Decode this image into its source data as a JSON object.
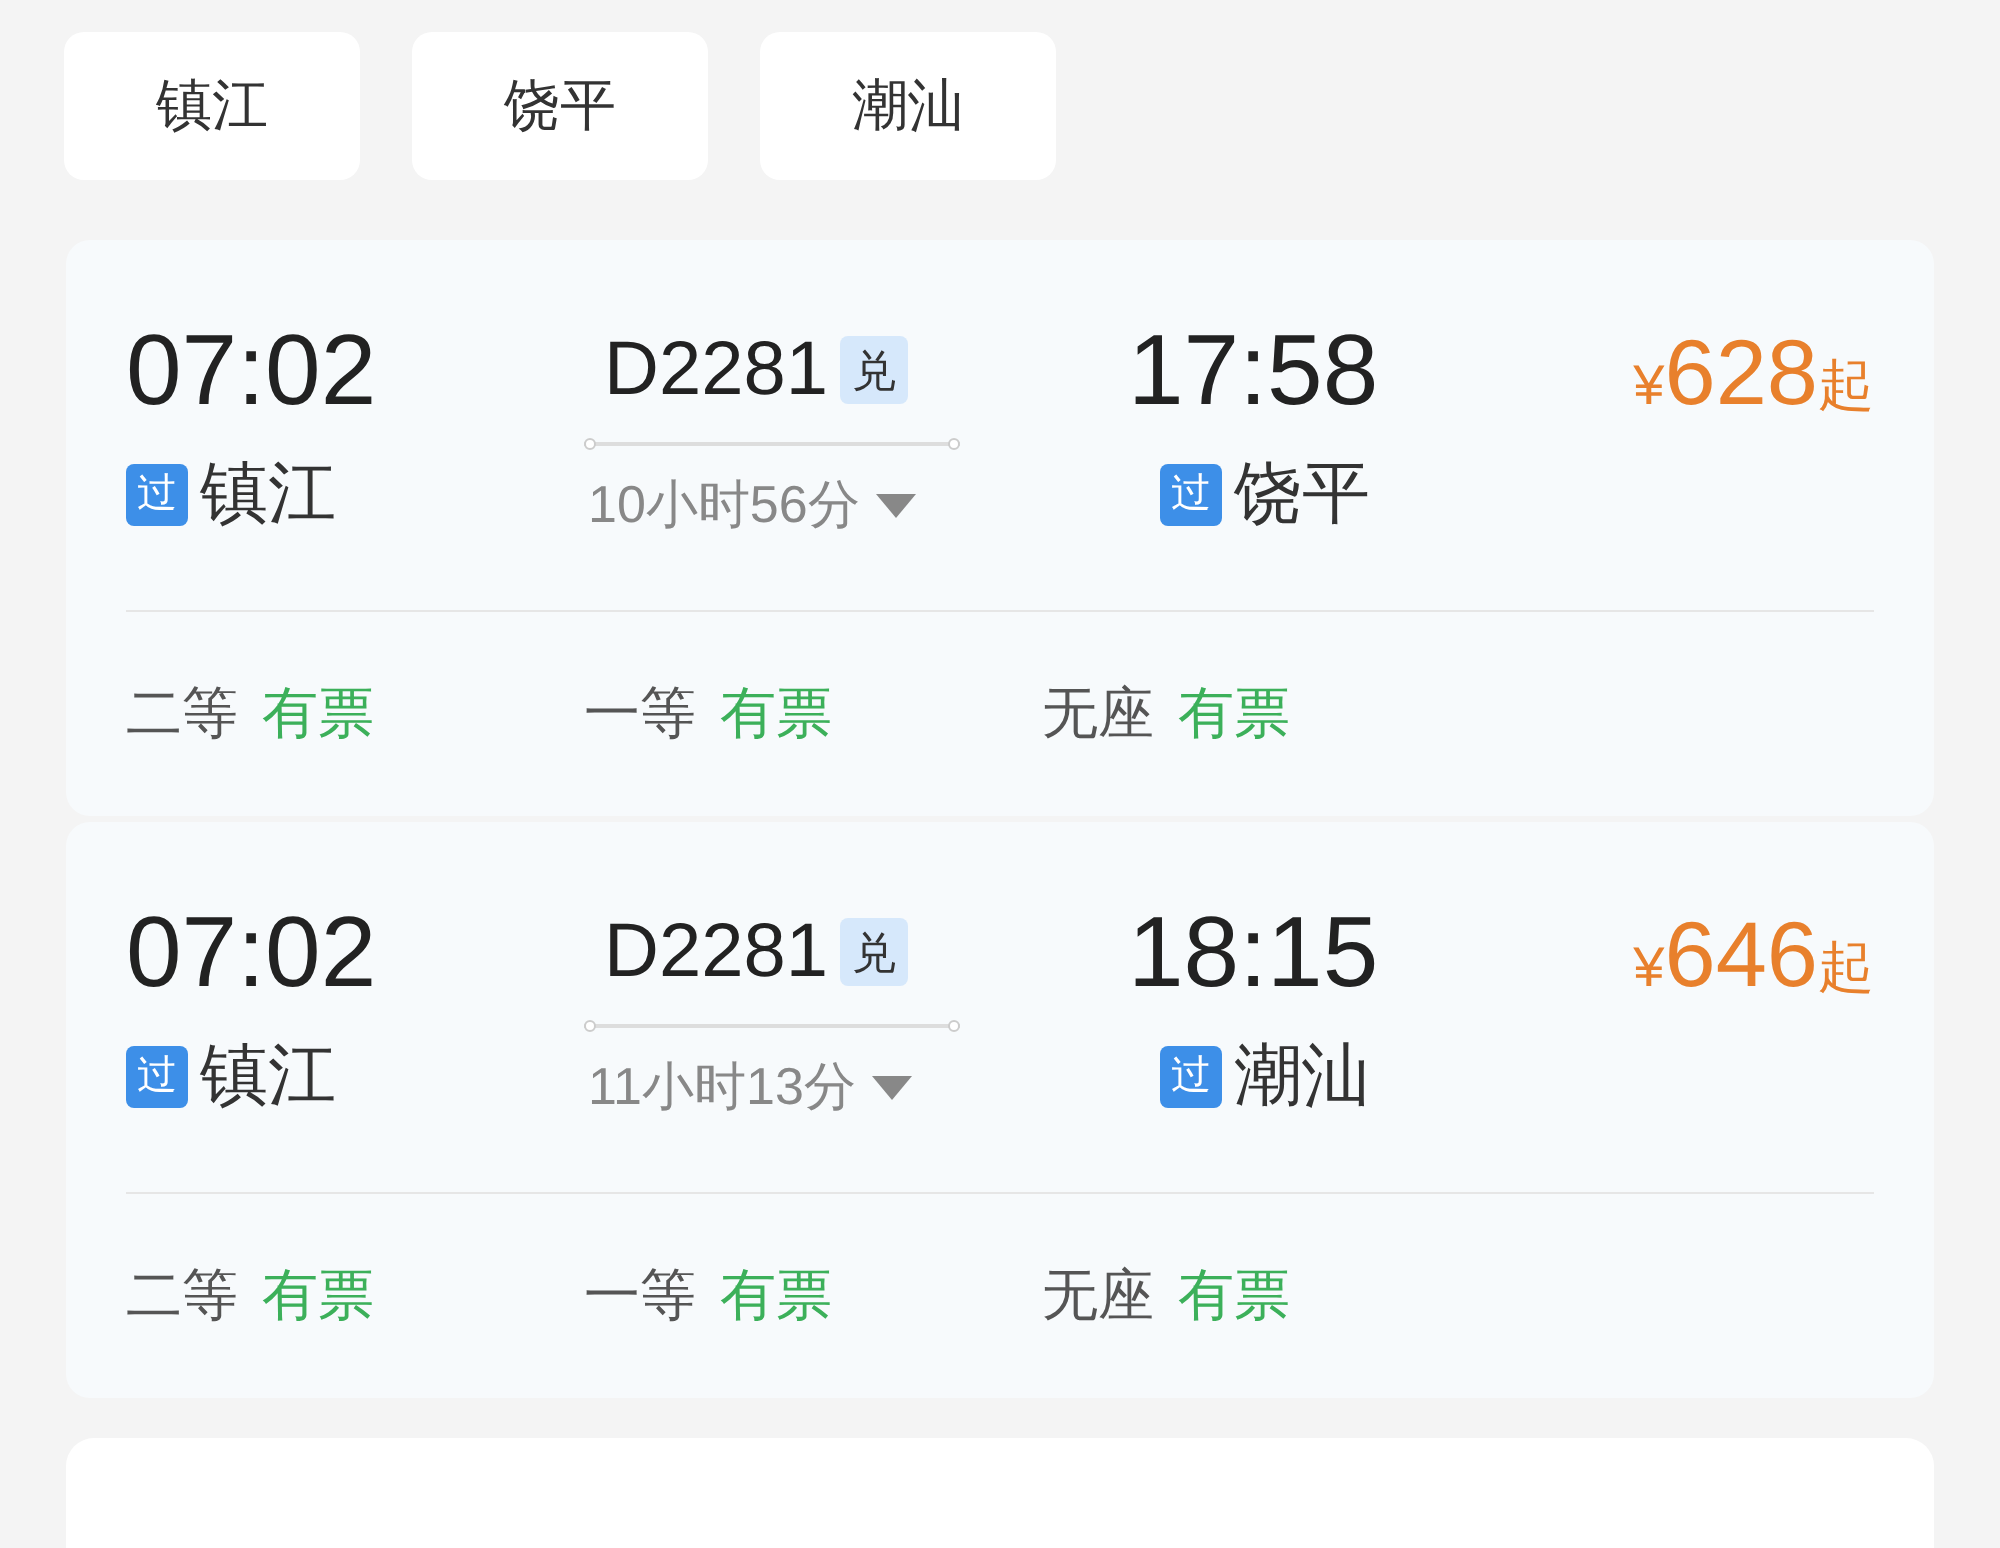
{
  "station_chips": [
    {
      "label": "镇江"
    },
    {
      "label": "饶平"
    },
    {
      "label": "潮汕"
    }
  ],
  "trains": [
    {
      "depart_time": "07:02",
      "depart_badge": "过",
      "depart_station": "镇江",
      "train_no": "D2281",
      "train_tag": "兑",
      "duration": "10小时56分",
      "arrive_time": "17:58",
      "arrive_badge": "过",
      "arrive_station": "饶平",
      "currency": "¥",
      "price": "628",
      "price_suffix": "起",
      "seats": [
        {
          "class": "二等",
          "status": "有票"
        },
        {
          "class": "一等",
          "status": "有票"
        },
        {
          "class": "无座",
          "status": "有票"
        }
      ]
    },
    {
      "depart_time": "07:02",
      "depart_badge": "过",
      "depart_station": "镇江",
      "train_no": "D2281",
      "train_tag": "兑",
      "duration": "11小时13分",
      "arrive_time": "18:15",
      "arrive_badge": "过",
      "arrive_station": "潮汕",
      "currency": "¥",
      "price": "646",
      "price_suffix": "起",
      "seats": [
        {
          "class": "二等",
          "status": "有票"
        },
        {
          "class": "一等",
          "status": "有票"
        },
        {
          "class": "无座",
          "status": "有票"
        }
      ]
    }
  ]
}
